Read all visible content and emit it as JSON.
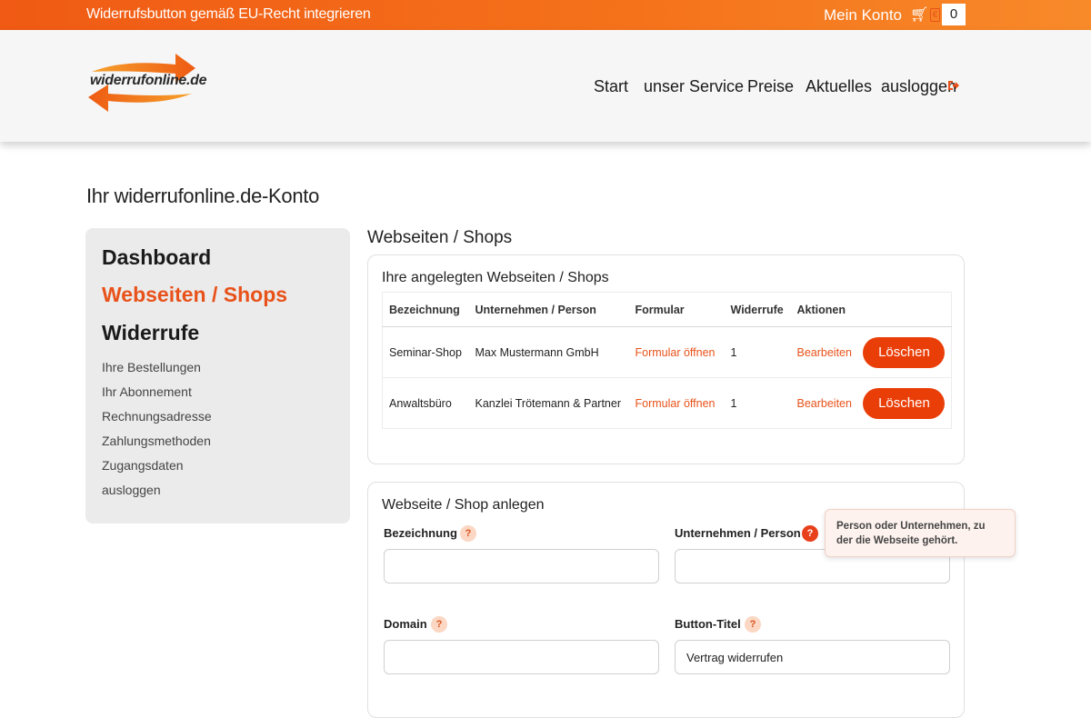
{
  "topbar": {
    "promo": "Widerrufsbutton gemäß EU-Recht integrieren",
    "account": "Mein Konto",
    "cart_count": "0",
    "tag_glyph": "€"
  },
  "logo": {
    "text": "widerrufonline.de"
  },
  "nav": {
    "items": [
      "Start",
      "unser Service",
      "Preise",
      "Aktuelles",
      "ausloggen"
    ]
  },
  "page_title": "Ihr widerrufonline.de-Konto",
  "sidebar": {
    "main": [
      "Dashboard",
      "Webseiten / Shops",
      "Widerrufe"
    ],
    "sub": [
      "Ihre Bestellungen",
      "Ihr Abonnement",
      "Rechnungsadresse",
      "Zahlungsmethoden",
      "Zugangsdaten",
      "ausloggen"
    ]
  },
  "section_title": "Webseiten / Shops",
  "list_card": {
    "title": "Ihre angelegten Webseiten / Shops",
    "columns": [
      "Bezeichnung",
      "Unternehmen / Person",
      "Formular",
      "Widerrufe",
      "Aktionen"
    ],
    "rows": [
      {
        "name": "Seminar-Shop",
        "company": "Max Mustermann GmbH",
        "form": "Formular öffnen",
        "count": "1",
        "edit": "Bearbeiten",
        "delete": "Löschen"
      },
      {
        "name": "Anwaltsbüro",
        "company": "Kanzlei Trötemann & Partner",
        "form": "Formular öffnen",
        "count": "1",
        "edit": "Bearbeiten",
        "delete": "Löschen"
      }
    ]
  },
  "form_card": {
    "title": "Webseite / Shop anlegen",
    "fields": {
      "name": {
        "label": "Bezeichnung",
        "value": ""
      },
      "company": {
        "label": "Unternehmen / Person",
        "value": ""
      },
      "domain": {
        "label": "Domain",
        "value": ""
      },
      "button_title": {
        "label": "Button-Titel",
        "value": "Vertrag widerrufen"
      }
    },
    "help_glyph": "?"
  },
  "tooltip": "Person oder Unternehmen, zu der die Webseite gehört.",
  "colors": {
    "accent": "#e8521a",
    "button": "#ea3e08",
    "topbar": "#f05a14"
  }
}
